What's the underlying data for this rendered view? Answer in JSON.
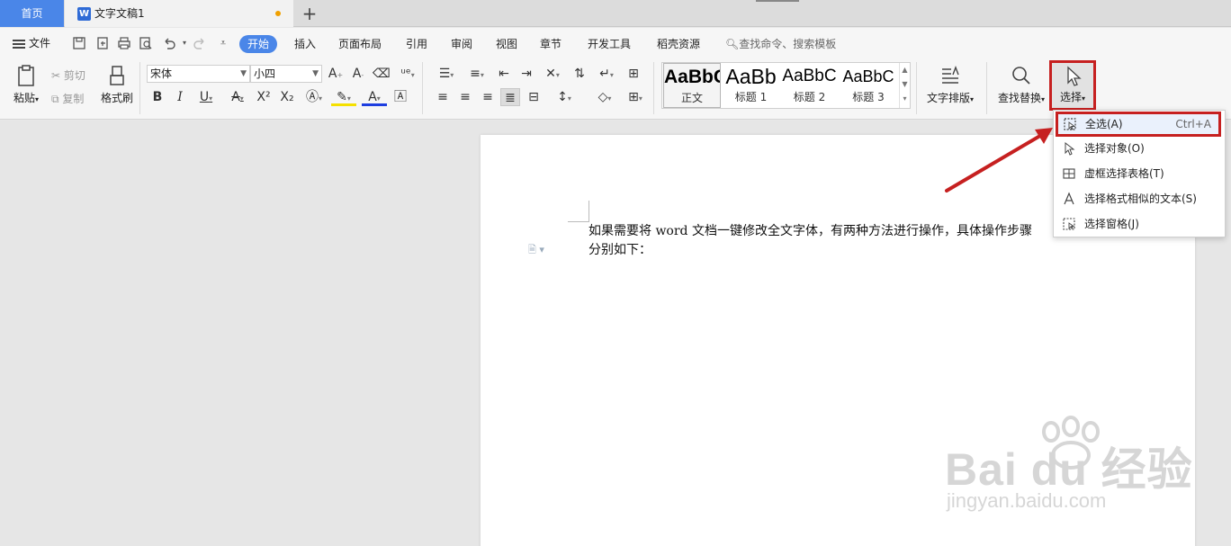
{
  "titlebar": {
    "home_tab": "首页",
    "doc_tab": "文字文稿1",
    "doc_tab_icon": "W",
    "new_tab": "+"
  },
  "menubar": {
    "file": "文件",
    "tabs": [
      "开始",
      "插入",
      "页面布局",
      "引用",
      "审阅",
      "视图",
      "章节",
      "开发工具",
      "稻壳资源"
    ],
    "active_tab": "开始",
    "search": "查找命令、搜索模板"
  },
  "ribbon": {
    "paste": "粘贴",
    "cut": "剪切",
    "copy": "复制",
    "format_painter": "格式刷",
    "font_name": "宋体",
    "font_size": "小四",
    "styles": [
      {
        "preview": "AaBbC",
        "name": "正文"
      },
      {
        "preview": "AaBb",
        "name": "标题 1"
      },
      {
        "preview": "AaBbC",
        "name": "标题 2"
      },
      {
        "preview": "AaBbC",
        "name": "标题 3"
      }
    ],
    "text_layout": "文字排版",
    "find_replace": "查找替换",
    "select": "选择"
  },
  "dropdown": {
    "items": [
      {
        "label": "全选(A)",
        "shortcut": "Ctrl+A",
        "icon": "select-all-icon"
      },
      {
        "label": "选择对象(O)",
        "shortcut": "",
        "icon": "pointer-icon"
      },
      {
        "label": "虚框选择表格(T)",
        "shortcut": "",
        "icon": "table-select-icon"
      },
      {
        "label": "选择格式相似的文本(S)",
        "shortcut": "",
        "icon": "similar-format-icon"
      },
      {
        "label": "选择窗格(J)",
        "shortcut": "",
        "icon": "selection-pane-icon"
      }
    ]
  },
  "document": {
    "line1": "如果需要将 word 文档一键修改全文字体，有两种方法进行操作，具体操作步骤",
    "line2": "分别如下："
  },
  "watermark": {
    "brand": "Bai du 经验",
    "url": "jingyan.baidu.com"
  },
  "colors": {
    "accent": "#4a86e8",
    "highlight_border": "#c62020"
  }
}
